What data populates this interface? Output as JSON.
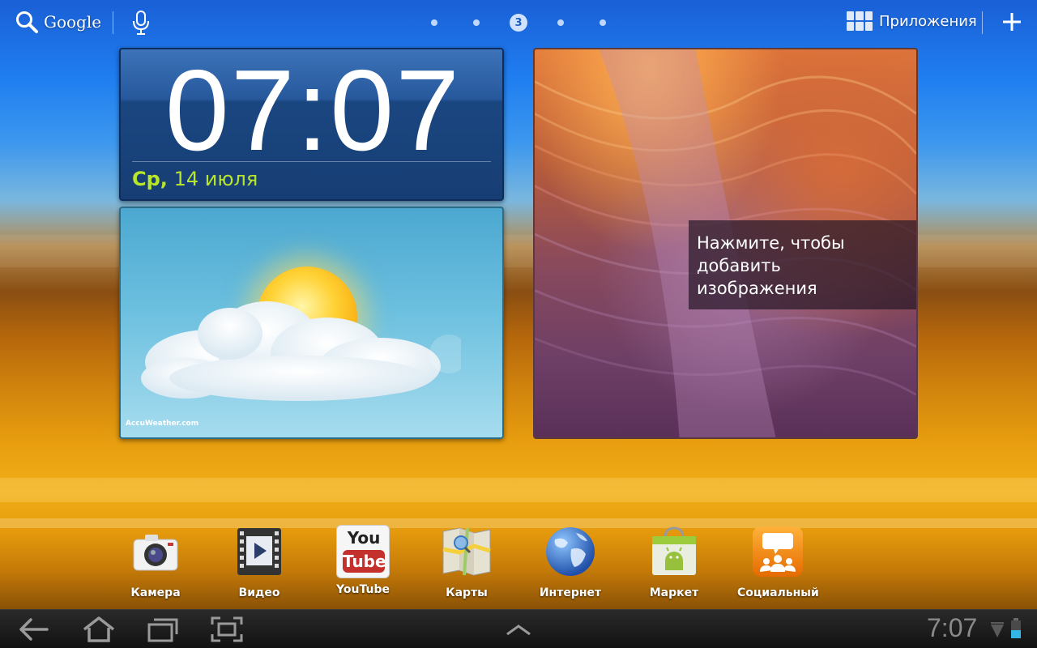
{
  "topbar": {
    "search_label": "Google",
    "apps_label": "Приложения",
    "current_page": "3",
    "page_count": 5
  },
  "clock": {
    "time": "07:07",
    "day": "Ср,",
    "date": "14 июля"
  },
  "weather": {
    "brand": "AccuWeather.com"
  },
  "photo_frame": {
    "hint_line1": "Нажмите, чтобы",
    "hint_line2": "добавить",
    "hint_line3": "изображения"
  },
  "dock": {
    "items": [
      {
        "label": "Камера",
        "icon": "camera-icon"
      },
      {
        "label": "Видео",
        "icon": "video-icon"
      },
      {
        "label": "YouTube",
        "icon": "youtube-icon"
      },
      {
        "label": "Карты",
        "icon": "maps-icon"
      },
      {
        "label": "Интернет",
        "icon": "globe-icon"
      },
      {
        "label": "Маркет",
        "icon": "market-icon"
      },
      {
        "label": "Социальный",
        "icon": "social-icon"
      }
    ],
    "youtube_you": "You",
    "youtube_tube": "Tube"
  },
  "sysbar": {
    "time": "7:07"
  },
  "colors": {
    "date_accent": "#b8e62a",
    "clock_bg": "#1a4680",
    "sysbar_bg": "#121212"
  }
}
